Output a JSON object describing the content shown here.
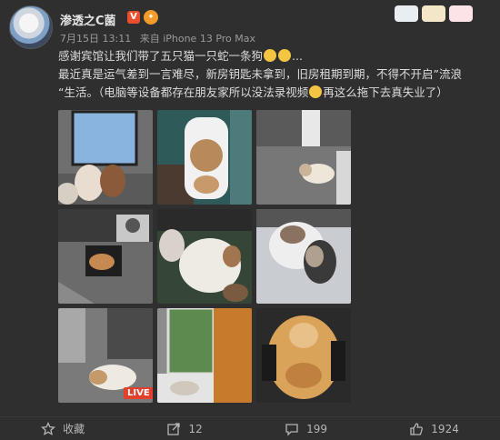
{
  "post": {
    "author": "渗透之C菌",
    "vip_badge": "V",
    "date": "7月15日 13:11",
    "source": "来自 iPhone 13 Pro Max",
    "line1": "感谢宾馆让我们带了五只猫一只蛇一条狗",
    "line1_tail": "...",
    "line2": "最近真是运气差到一言难尽，新房钥匙未拿到，旧房租期到期，不得不开启”流浪",
    "line3": "“生活。（电脑等设备都存在朋友家所以没法录视频",
    "line3_tail": "再这么拖下去真失业了）",
    "live_badge": "LIVE"
  },
  "actions": {
    "favorite": "收藏",
    "reposts": "12",
    "comments": "199",
    "likes": "1924"
  },
  "icons": [
    "star-icon",
    "repost-icon",
    "comment-icon",
    "like-icon"
  ]
}
